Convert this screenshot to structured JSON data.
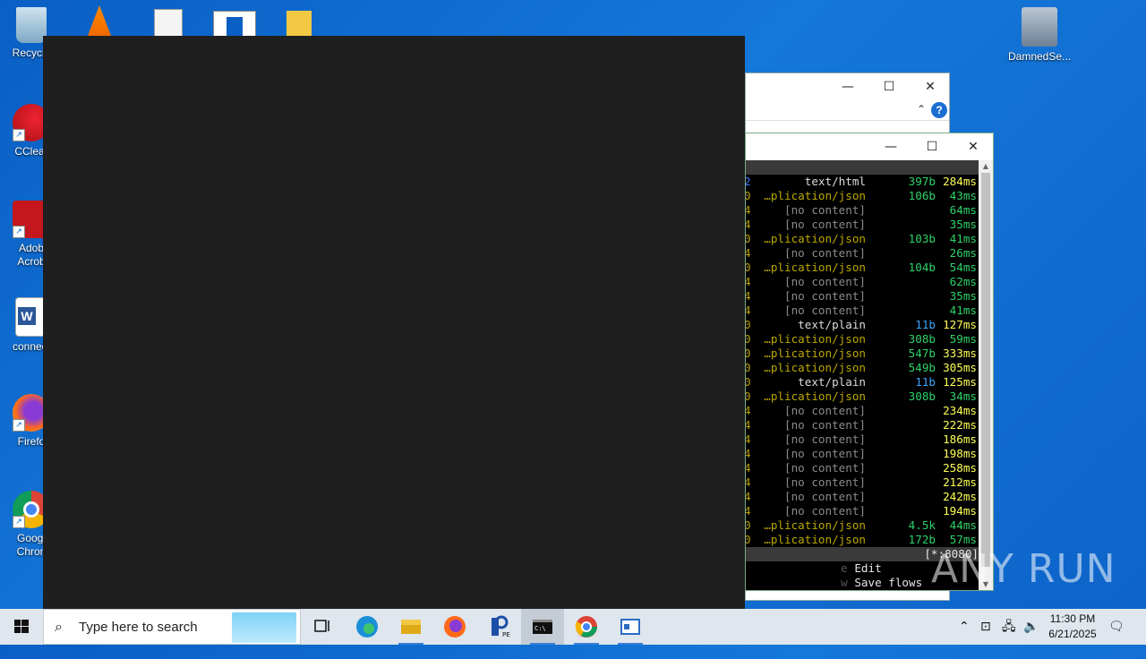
{
  "desktop": {
    "icons": [
      {
        "label": "Recycle"
      },
      {
        "label": "CClear"
      },
      {
        "label": "Adob\nAcrob"
      },
      {
        "label": "connect"
      },
      {
        "label": "Firefo"
      },
      {
        "label": "Googl\nChron"
      },
      {
        "label": "DamnedSe..."
      }
    ]
  },
  "terminal": {
    "rows": [
      {
        "lead": "2",
        "type": "text/html",
        "size": "397b",
        "time": "284ms"
      },
      {
        "lead": "0",
        "type": "…plication/json",
        "size": "106b",
        "time": "43ms"
      },
      {
        "lead": "4",
        "type": "[no content]",
        "size": "",
        "time": "64ms"
      },
      {
        "lead": "4",
        "type": "[no content]",
        "size": "",
        "time": "35ms"
      },
      {
        "lead": "0",
        "type": "…plication/json",
        "size": "103b",
        "time": "41ms"
      },
      {
        "lead": "4",
        "type": "[no content]",
        "size": "",
        "time": "26ms"
      },
      {
        "lead": "0",
        "type": "…plication/json",
        "size": "104b",
        "time": "54ms"
      },
      {
        "lead": "4",
        "type": "[no content]",
        "size": "",
        "time": "62ms"
      },
      {
        "lead": "4",
        "type": "[no content]",
        "size": "",
        "time": "35ms"
      },
      {
        "lead": "4",
        "type": "[no content]",
        "size": "",
        "time": "41ms"
      },
      {
        "lead": "0",
        "type": "text/plain",
        "size": "11b",
        "time": "127ms"
      },
      {
        "lead": "0",
        "type": "…plication/json",
        "size": "308b",
        "time": "59ms"
      },
      {
        "lead": "0",
        "type": "…plication/json",
        "size": "547b",
        "time": "333ms"
      },
      {
        "lead": "0",
        "type": "…plication/json",
        "size": "549b",
        "time": "305ms"
      },
      {
        "lead": "0",
        "type": "text/plain",
        "size": "11b",
        "time": "125ms"
      },
      {
        "lead": "0",
        "type": "…plication/json",
        "size": "308b",
        "time": "34ms"
      },
      {
        "lead": "4",
        "type": "[no content]",
        "size": "",
        "time": "234ms"
      },
      {
        "lead": "4",
        "type": "[no content]",
        "size": "",
        "time": "222ms"
      },
      {
        "lead": "4",
        "type": "[no content]",
        "size": "",
        "time": "186ms"
      },
      {
        "lead": "4",
        "type": "[no content]",
        "size": "",
        "time": "198ms"
      },
      {
        "lead": "4",
        "type": "[no content]",
        "size": "",
        "time": "258ms"
      },
      {
        "lead": "4",
        "type": "[no content]",
        "size": "",
        "time": "212ms"
      },
      {
        "lead": "4",
        "type": "[no content]",
        "size": "",
        "time": "242ms"
      },
      {
        "lead": "4",
        "type": "[no content]",
        "size": "",
        "time": "194ms"
      },
      {
        "lead": "0",
        "type": "…plication/json",
        "size": "4.5k",
        "time": "44ms"
      },
      {
        "lead": "0",
        "type": "…plication/json",
        "size": "172b",
        "time": "57ms"
      }
    ],
    "status": "[*:8080]",
    "keys": [
      {
        "key": "e",
        "label": "Edit"
      },
      {
        "key": "w",
        "label": "Save flows"
      }
    ]
  },
  "window_controls": {
    "minimize": "—",
    "maximize": "☐",
    "close": "✕"
  },
  "watermark": "ANY RUN",
  "taskbar": {
    "search_placeholder": "Type here to search",
    "time": "11:30 PM",
    "date": "6/21/2025"
  },
  "colors": {
    "desktop": "#1478d8",
    "dark_window": "#1f1f1f",
    "terminal_bg": "#000000",
    "taskbar": "#dfe6ee"
  }
}
